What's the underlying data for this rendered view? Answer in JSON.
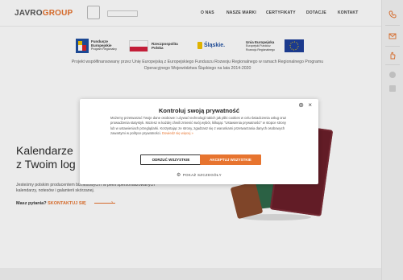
{
  "header": {
    "logo_a": "JAVRO",
    "logo_b": "GROUP",
    "nav": [
      "O NAS",
      "NASZE MARKI",
      "CERTYFIKATY",
      "DOTACJE",
      "KONTAKT"
    ]
  },
  "sidebar": {
    "icons": [
      "phone-icon",
      "mail-icon",
      "hand-icon",
      "facebook-icon",
      "instagram-icon"
    ]
  },
  "eu": {
    "fundusze_line1": "Fundusze",
    "fundusze_line2": "Europejskie",
    "fundusze_line3": "Program Regionalny",
    "rp_line1": "Rzeczpospolita",
    "rp_line2": "Polska",
    "slaskie": "Śląskie.",
    "ue_line1": "Unia Europejska",
    "ue_line2": "Europejski Fundusz",
    "ue_line3": "Rozwoju Regionalnego",
    "project_text": "Projekt współfinansowany przez Unię Europejską z Europejskiego Funduszu Rozwoju Regionalnego w ramach Regionalnego Programu Operacyjnego Województwa Śląskiego na lata 2014-2020"
  },
  "hero": {
    "title_line1": "Kalendarze",
    "title_line2": "z Twoim log",
    "description": "Jesteśmy polskim producentem biznesowych i w pełni spersonalizowanych kalendarzy, notesów i galanterii skórzanej.",
    "cta_question": "Masz pytania?",
    "cta_link": "SKONTAKTUJ SIĘ"
  },
  "cookie": {
    "title": "Kontroluj swoją prywatność",
    "body": "Możemy przetwarzać Twoje dane osobowe i używać technologii takich jak pliki cookies w celu świadczenia usług oraz prowadzenia statystyk. Możesz w każdej chwili zmienić swój wybór, klikając \"Ustawienia prywatności\" w stopce strony lub w ustawieniach przeglądarki. Korzystając ze strony, zgadzasz się z warunkami przetwarzania danych osobowych zawartymi w polityce prywatności.",
    "more": "Dowiedz się więcej »",
    "reject_label": "ODRZUĆ WSZYSTKIE",
    "accept_label": "AKCEPTUJ WSZYSTKIE",
    "details_label": "POKAŻ SZCZEGÓŁY",
    "close_glyph": "×",
    "lang_glyph": "⊕"
  },
  "colors": {
    "accent": "#e7742f",
    "book_maroon": "#6b1f2a",
    "book_green": "#2f6a4a",
    "book_brown": "#8a4b2d"
  }
}
